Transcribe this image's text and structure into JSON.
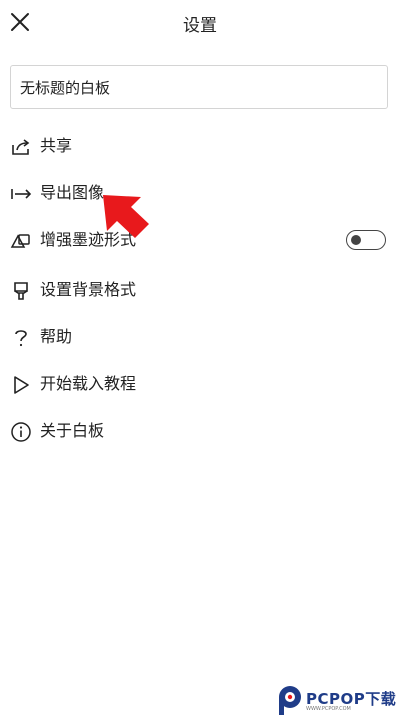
{
  "header": {
    "title": "设置",
    "close_icon": "close-icon"
  },
  "board_name": {
    "value": "无标题的白板"
  },
  "menu": [
    {
      "key": "share",
      "label": "共享",
      "icon": "share-icon"
    },
    {
      "key": "export-image",
      "label": "导出图像",
      "icon": "export-arrow-icon"
    },
    {
      "key": "ink-enhance",
      "label": "增强墨迹形式",
      "icon": "ink-shapes-icon",
      "toggle": {
        "on": false
      }
    },
    {
      "key": "background-format",
      "label": "设置背景格式",
      "icon": "paint-brush-icon"
    },
    {
      "key": "help",
      "label": "帮助",
      "icon": "question-icon"
    },
    {
      "key": "tutorial",
      "label": "开始载入教程",
      "icon": "play-icon"
    },
    {
      "key": "about",
      "label": "关于白板",
      "icon": "info-icon"
    }
  ],
  "annotation": {
    "arrow_color": "#e8191c",
    "points_to": "export-image"
  },
  "watermark": {
    "brand": "PCPOP下载",
    "sub": "WWW.PCPOP.COM",
    "color": "#1f3c88"
  }
}
